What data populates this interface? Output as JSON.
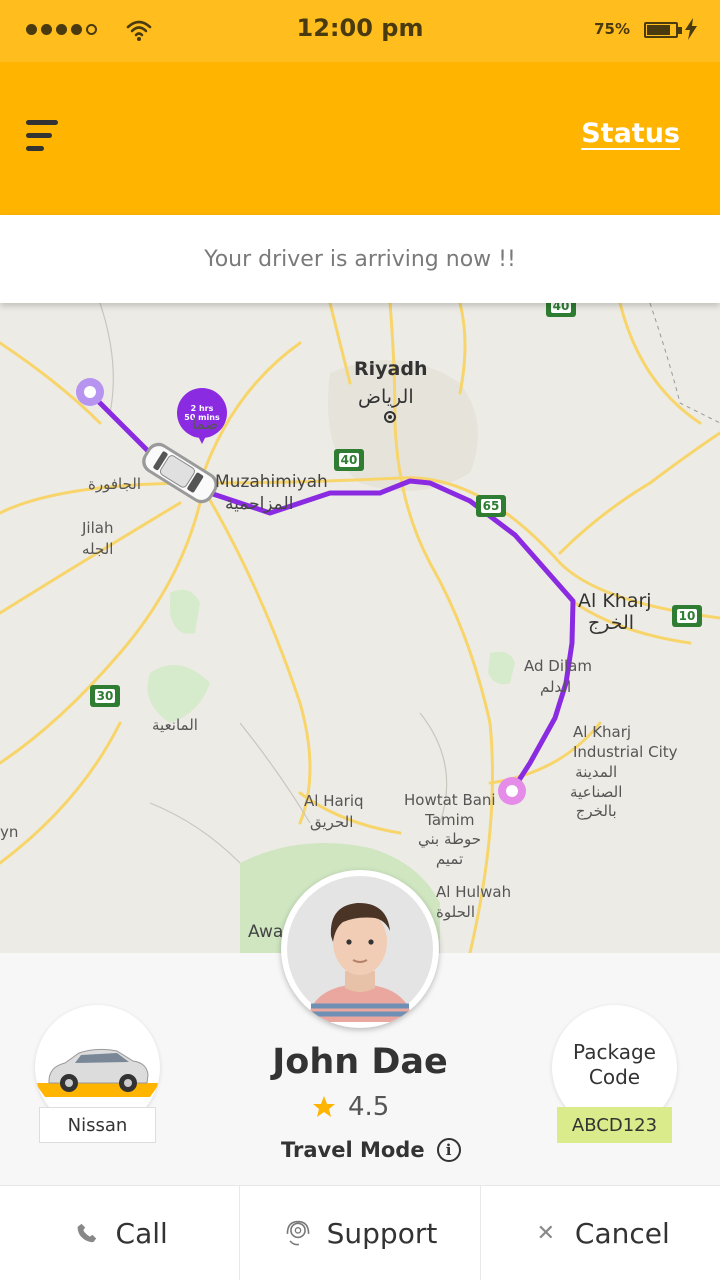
{
  "status_bar": {
    "time": "12:00 pm",
    "battery": "75%",
    "signal_strength": 4,
    "icons": [
      "signal-dots",
      "wifi-icon",
      "battery-icon",
      "charging-bolt-icon"
    ]
  },
  "header": {
    "menu_icon": "menu-icon",
    "status_label": "Status",
    "background": "#FFB400"
  },
  "message": "Your driver is arriving now !!",
  "map": {
    "eta_line1": "2 hrs",
    "eta_line2": "50 mins",
    "route_color": "#8A2BE2",
    "labels": {
      "riyadh_en": "Riyadh",
      "riyadh_ar": "الرياض",
      "muzahimiyah_en": "Muzahimiyah",
      "muzahimiyah_ar": "المزاحمية",
      "jafurah_ar": "الجافورة",
      "jilah_en": "Jilah",
      "jilah_ar": "الجله",
      "alkharj_en": "Al Kharj",
      "alkharj_ar": "الخرج",
      "addilam_en": "Ad Dilam",
      "addilam_ar": "الدلم",
      "industrial_en": "Al Kharj\nIndustrial City",
      "industrial_ar": "المدينة\nالصناعية\nبالخرج",
      "almania_ar": "المانعية",
      "alhariq_en": "Al Hariq",
      "alhariq_ar": "الحريق",
      "howtat_en": "Howtat Bani\nTamim",
      "howtat_ar": "حوطة بني\nتميم",
      "alhulwah_en": "Al Hulwah",
      "alhulwah_ar": "الحلوة",
      "awa": "Awa",
      "yn": "yn",
      "sub_ar": "ضما"
    },
    "shields": [
      "40",
      "40",
      "65",
      "10",
      "30"
    ]
  },
  "driver": {
    "name": "John Dae",
    "rating": "4.5",
    "travel_mode_label": "Travel Mode",
    "info_glyph": "i"
  },
  "vehicle": {
    "model": "Nissan"
  },
  "package": {
    "title": "Package\nCode",
    "code": "ABCD123"
  },
  "actions": {
    "call": "Call",
    "support": "Support",
    "cancel": "Cancel",
    "cancel_glyph": "✕"
  }
}
